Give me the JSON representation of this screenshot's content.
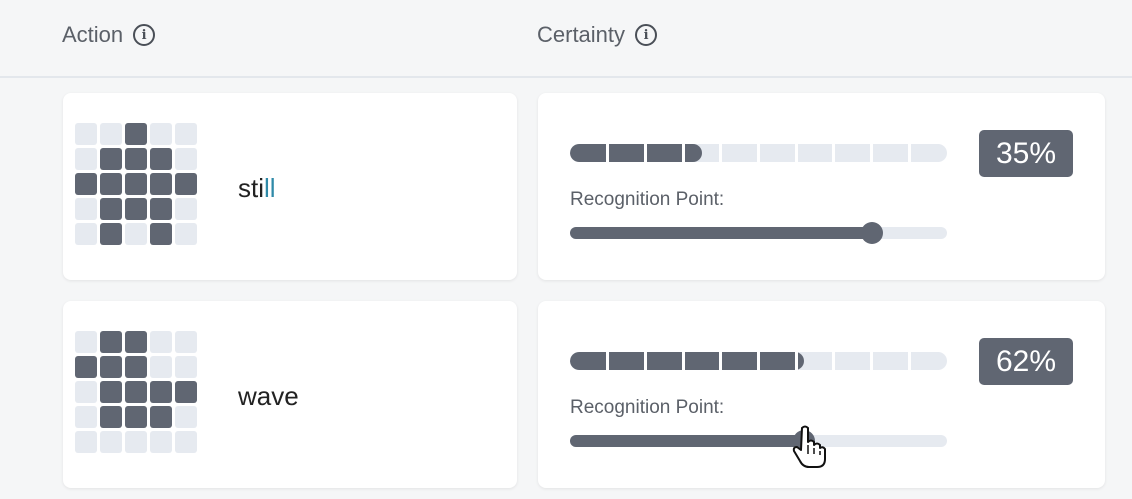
{
  "header": {
    "action_label": "Action",
    "certainty_label": "Certainty"
  },
  "rows": [
    {
      "action_prefix": "sti",
      "action_highlight": "ll",
      "grid": [
        [
          0,
          0,
          1,
          0,
          0
        ],
        [
          0,
          1,
          1,
          1,
          0
        ],
        [
          1,
          1,
          1,
          1,
          1
        ],
        [
          0,
          1,
          1,
          1,
          0
        ],
        [
          0,
          1,
          0,
          1,
          0
        ]
      ],
      "certainty": 0.35,
      "certainty_text": "35%",
      "recognition_label": "Recognition Point:",
      "recognition_point": 0.8
    },
    {
      "action_prefix": "wave",
      "action_highlight": "",
      "grid": [
        [
          0,
          1,
          1,
          0,
          0
        ],
        [
          1,
          1,
          1,
          0,
          0
        ],
        [
          0,
          1,
          1,
          1,
          1
        ],
        [
          0,
          1,
          1,
          1,
          0
        ],
        [
          0,
          0,
          0,
          0,
          0
        ]
      ],
      "certainty": 0.62,
      "certainty_text": "62%",
      "recognition_label": "Recognition Point:",
      "recognition_point": 0.62
    }
  ],
  "colors": {
    "dark": "#606672",
    "light": "#e6eaf0",
    "highlight": "#2f8aa8"
  },
  "icons": {
    "info": "info-icon",
    "cursor": "hand-pointer-cursor-icon"
  }
}
